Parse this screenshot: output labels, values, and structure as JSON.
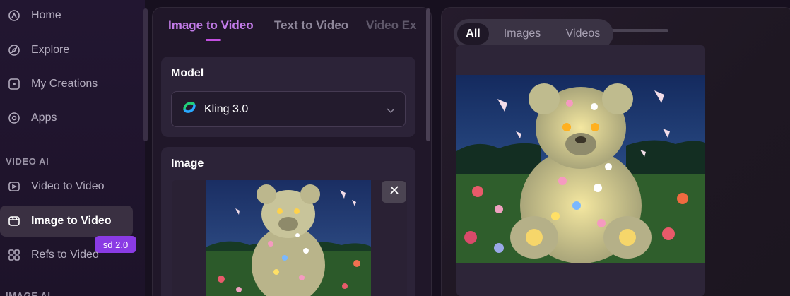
{
  "sidebar": {
    "items": [
      {
        "label": "Home",
        "icon": "home-icon"
      },
      {
        "label": "Explore",
        "icon": "explore-icon"
      },
      {
        "label": "My Creations",
        "icon": "creations-icon"
      },
      {
        "label": "Apps",
        "icon": "apps-icon"
      }
    ],
    "section_video": "VIDEO AI",
    "video_items": [
      {
        "label": "Video to Video",
        "icon": "video-icon"
      },
      {
        "label": "Image to Video",
        "icon": "image-video-icon",
        "active": true
      },
      {
        "label": "Refs to Video",
        "icon": "refs-icon"
      }
    ],
    "badge": "sd 2.0",
    "section_next": "IMAGE AI"
  },
  "tabs": {
    "image_to_video": "Image to Video",
    "text_to_video": "Text to Video",
    "video_ex": "Video Ex"
  },
  "model": {
    "title": "Model",
    "selected": "Kling 3.0"
  },
  "image": {
    "title": "Image"
  },
  "gallery": {
    "filters": [
      "All",
      "Images",
      "Videos"
    ],
    "active_filter": "All"
  },
  "colors": {
    "accent": "#c27be8",
    "badge": "#8a3be4",
    "active_item_bg": "#3a3042"
  }
}
